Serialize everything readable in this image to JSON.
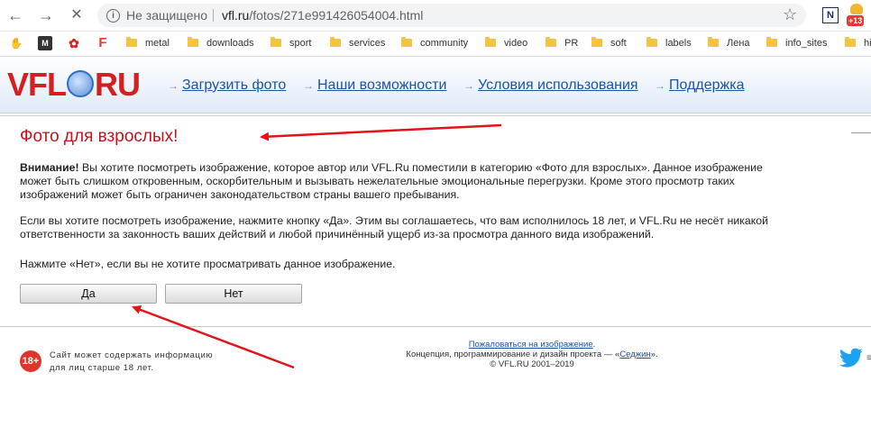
{
  "browser": {
    "security_label": "Не защищено",
    "url_host": "vfl.ru",
    "url_path": "/fotos/271e991426054004.html",
    "ext_badge": "+13",
    "ext_letter": "N"
  },
  "bookmarks": [
    {
      "label": "metal"
    },
    {
      "label": "downloads"
    },
    {
      "label": "sport"
    },
    {
      "label": "services"
    },
    {
      "label": "community"
    },
    {
      "label": "video"
    },
    {
      "label": "PR"
    },
    {
      "label": "soft"
    },
    {
      "label": "labels"
    },
    {
      "label": "Лена"
    },
    {
      "label": "info_sites"
    },
    {
      "label": "hi"
    }
  ],
  "site": {
    "logo_left": "VFL",
    "logo_right": "RU",
    "menu": [
      {
        "label": "Загрузить фото"
      },
      {
        "label": "Наши возможности"
      },
      {
        "label": "Условия использования"
      },
      {
        "label": "Поддержка"
      }
    ]
  },
  "page": {
    "title": "Фото для взрослых!",
    "warning_bold": "Внимание!",
    "warning_line1": " Вы хотите посмотреть изображение, которое автор или VFL.Ru поместили в категорию «Фото для взрослых». Данное изображение",
    "warning_line2": "может быть слишком откровенным, оскорбительным и вызывать нежелательные эмоциональные перегрузки. Кроме этого просмотр таких",
    "warning_line3": "изображений может быть ограничен законодательством страны вашего пребывания.",
    "consent_line1": "Если вы хотите посмотреть изображение, нажмите кнопку «Да». Этим вы соглашаетесь, что вам исполнилось 18 лет, и VFL.Ru не несёт никакой",
    "consent_line2": "ответственности за законность ваших действий и любой причинённый ущерб из-за просмотра данного вида изображений.",
    "no_line": "Нажмите «Нет», если вы не хотите просматривать данное изображение.",
    "yes_button": "Да",
    "no_button": "Нет"
  },
  "footer": {
    "age_badge": "18+",
    "age_line1": "Сайт может содержать информацию",
    "age_line2": "для лиц старше 18 лет.",
    "complain_link": "Пожаловаться на изображение",
    "complain_dot": ".",
    "credits_prefix": "Концепция, программирование и дизайн проекта — «",
    "credits_author": "Седжин",
    "credits_suffix": "».",
    "copyright": "© VFL.RU 2001–2019"
  },
  "colors": {
    "accent_red": "#c0141a",
    "link_blue": "#1a55a6",
    "annotation_red": "#e0141a"
  }
}
